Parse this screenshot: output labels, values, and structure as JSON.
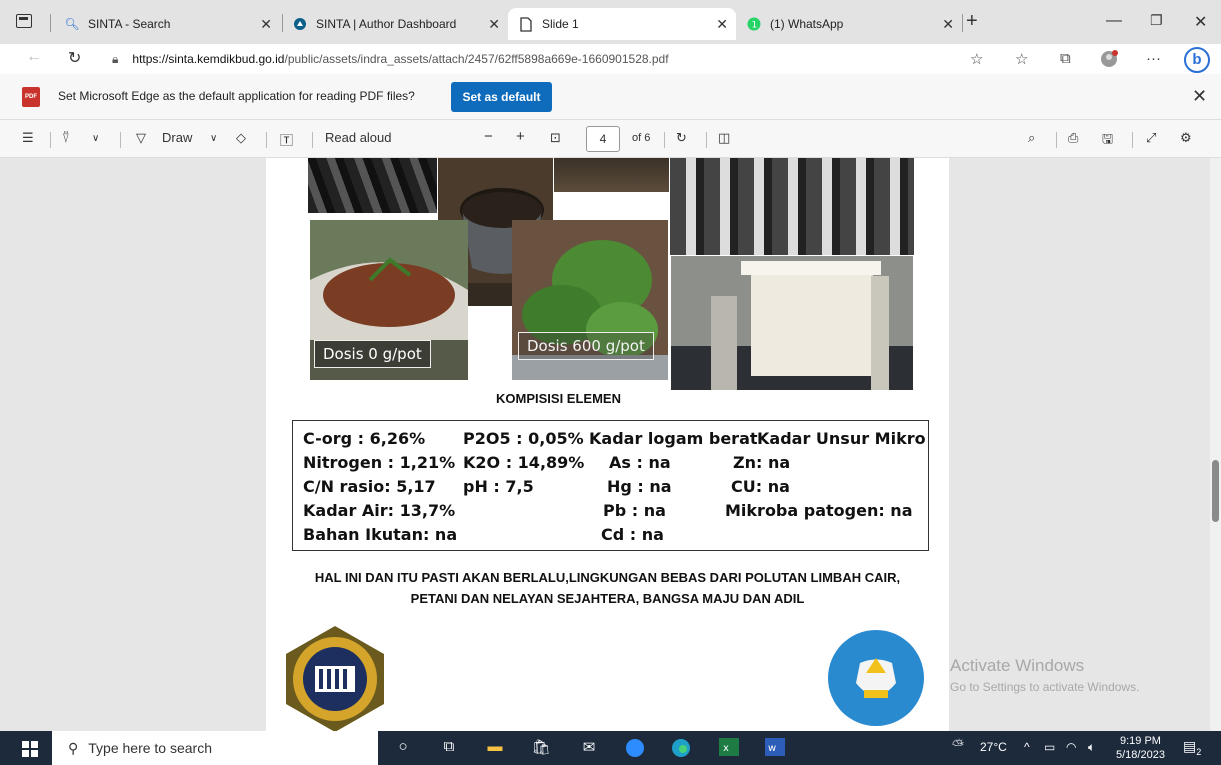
{
  "tabs": [
    {
      "label": "SINTA - Search",
      "icon": "search-icon"
    },
    {
      "label": "SINTA | Author Dashboard",
      "icon": "sinta-icon"
    },
    {
      "label": "Slide 1",
      "icon": "page-icon"
    },
    {
      "label": "(1) WhatsApp",
      "icon": "whatsapp-icon"
    }
  ],
  "url": {
    "host": "https://sinta.kemdikbud.go.id",
    "path": "/public/assets/indra_assets/attach/2457/62ff5898a669e-1660901528.pdf"
  },
  "infobar": {
    "message": "Set Microsoft Edge as the default application for reading PDF files?",
    "button": "Set as default"
  },
  "pdf_toolbar": {
    "draw": "Draw",
    "read_aloud": "Read aloud",
    "page_value": "4",
    "page_of": "of 6",
    "zoom_minus": "−",
    "zoom_plus": "+"
  },
  "slide": {
    "label_left": "Dosis 0 g/pot",
    "label_right": "Dosis  600 g/pot",
    "title": "KOMPISISI  ELEMEN",
    "rows": [
      [
        "C-org : 6,26%",
        "P2O5 : 0,05%",
        "Kadar logam berat",
        "Kadar Unsur Mikro"
      ],
      [
        "Nitrogen : 1,21%",
        "K2O  : 14,89%",
        "As  : na",
        "Zn: na"
      ],
      [
        "C/N rasio: 5,17",
        "pH    : 7,5",
        "Hg  : na",
        "CU: na"
      ],
      [
        "Kadar Air: 13,7%",
        "",
        "Pb  :  na",
        "Mikroba patogen: na"
      ],
      [
        "Bahan Ikutan: na",
        "",
        "Cd  :  na",
        ""
      ]
    ],
    "footer_line1": "HAL INI DAN ITU PASTI AKAN BERLALU,LINGKUNGAN BEBAS DARI POLUTAN LIMBAH CAIR,",
    "footer_line2": "PETANI DAN NELAYAN SEJAHTERA, BANGSA  MAJU DAN ADIL"
  },
  "watermark": {
    "line1": "Activate Windows",
    "line2": "Go to Settings to activate Windows."
  },
  "taskbar": {
    "search_placeholder": "Type here to search",
    "temp": "27°C",
    "time": "9:19 PM",
    "date": "5/18/2023",
    "notif_count": "2"
  }
}
